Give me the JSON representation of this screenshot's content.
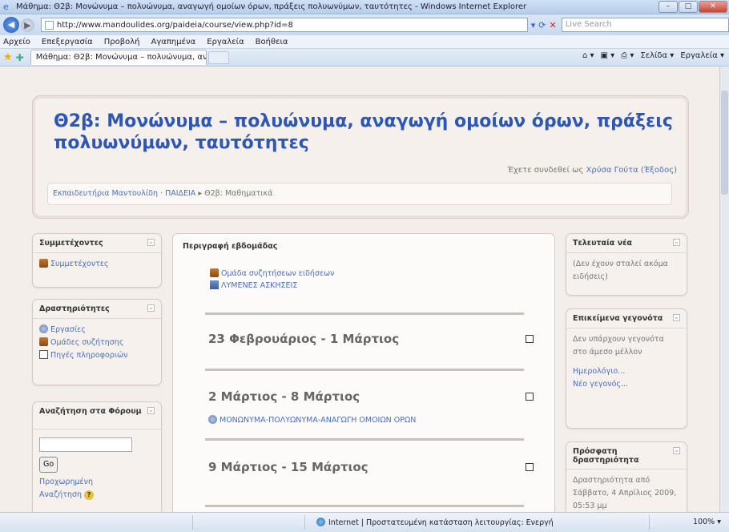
{
  "window": {
    "title": "Μάθημα: Θ2β: Μονώνυμα – πολυώνυμα, αναγωγή ομοίων όρων, πράξεις πολυωνύμων, ταυτότητες - Windows Internet Explorer",
    "min": "–",
    "max": "□",
    "close": "✕"
  },
  "address": {
    "url": "http://www.mandoulides.org/paideia/course/view.php?id=8",
    "search_placeholder": "Live Search"
  },
  "menu": [
    "Αρχείο",
    "Επεξεργασία",
    "Προβολή",
    "Αγαπημένα",
    "Εργαλεία",
    "Βοήθεια"
  ],
  "tabs": {
    "active": "Μάθημα: Θ2β: Μονώνυμα – πολυώνυμα, αναγ...",
    "tools": [
      "Σελίδα ▾",
      "Εργαλεία ▾"
    ]
  },
  "header": {
    "title": "Θ2β: Μονώνυμα – πολυώνυμα, αναγωγή ομοίων όρων, πράξεις πολυωνύμων, ταυτότητες",
    "logged_prefix": "Έχετε συνδεθεί ως",
    "user": "Χρύσα Γούτα",
    "logout": "(Έξοδος)",
    "breadcrumb": {
      "home": "Εκπαιδευτήρια Μαντουλίδη",
      "sep1": "ΠΑΙΔΕΙΑ",
      "current": "Θ2β: Μαθηματικά"
    }
  },
  "left": {
    "participants": {
      "title": "Συμμετέχοντες",
      "items": [
        "Συμμετέχοντες"
      ]
    },
    "activities": {
      "title": "Δραστηριότητες",
      "items": [
        "Εργασίες",
        "Ομάδες συζήτησης",
        "Πηγές πληροφοριών"
      ]
    },
    "search": {
      "title": "Αναζήτηση στα Φόρουμ",
      "go": "Go",
      "advanced": "Προχωρημένη Αναζήτηση"
    }
  },
  "main": {
    "heading": "Περιγραφή εβδομάδας",
    "topics": [
      "Ομάδα συζητήσεων ειδήσεων",
      "ΛΥΜΕΝΕΣ ΑΣΚΗΣΕΙΣ"
    ],
    "weeks": [
      {
        "label": "23 Φεβρουάριος - 1 Μάρτιος"
      },
      {
        "label": "2 Μάρτιος - 8 Μάρτιος",
        "activity": "ΜΟΝΩΝΥΜΑ-ΠΟΛΥΩΝΥΜΑ-ΑΝΑΓΩΓΗ ΟΜΟΙΩΝ ΟΡΩΝ"
      },
      {
        "label": "9 Μάρτιος - 15 Μάρτιος"
      }
    ]
  },
  "right": {
    "news": {
      "title": "Τελευταία νέα",
      "body": "(Δεν έχουν σταλεί ακόμα ειδήσεις)"
    },
    "events": {
      "title": "Επικείμενα γεγονότα",
      "body": "Δεν υπάρχουν γεγονότα στο άμεσο μέλλον",
      "calendar": "Ημερολόγιο...",
      "new_event": "Νέο γεγονός..."
    },
    "recent": {
      "title": "Πρόσφατη δραστηριότητα",
      "body": "Δραστηριότητα από Σάββατο, 4 Απρίλιος 2009, 05:53 μμ"
    }
  },
  "status": {
    "zone": "Internet | Προστατευμένη κατάσταση λειτουργίας: Ενεργή",
    "zoom": "100% ▾"
  }
}
